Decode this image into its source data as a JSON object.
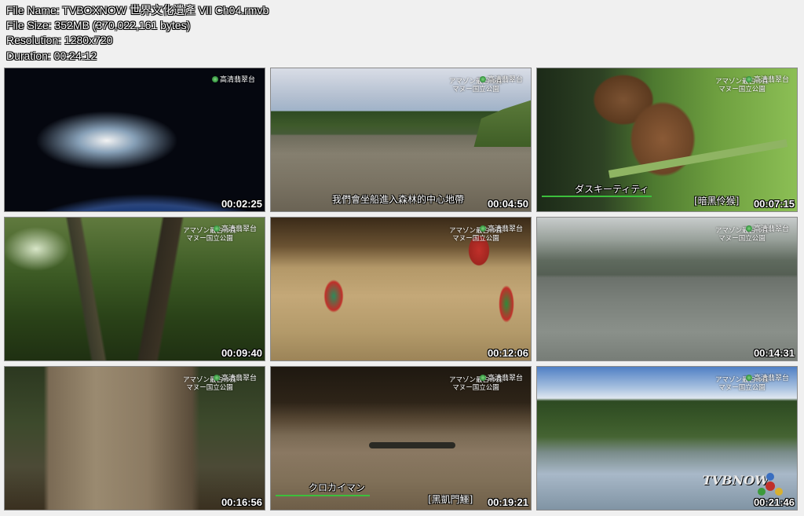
{
  "header": {
    "file_name": "File Name: TVBOXNOW 世界文化遺產 VII Ch04.rmvb",
    "file_size": "File Size: 352MB (370,022,161 bytes)",
    "resolution": "Resolution: 1280x720",
    "duration": "Duration: 00:24:12"
  },
  "overlay": {
    "channel_logo": "高清翡翠台",
    "place_line1": "アマゾン最古の森",
    "place_line2": "マヌー国立公園",
    "watermark": "TVBNOW"
  },
  "thumbnails": [
    {
      "time": "00:02:25"
    },
    {
      "time": "00:04:50",
      "subtitle": "我們會坐船進入森林的中心地帶"
    },
    {
      "time": "00:07:15",
      "caption": "ダスキーティティ",
      "caption2": "[暗黑伶猴]"
    },
    {
      "time": "00:09:40"
    },
    {
      "time": "00:12:06"
    },
    {
      "time": "00:14:31"
    },
    {
      "time": "00:16:56"
    },
    {
      "time": "00:19:21",
      "caption": "クロカイマン",
      "caption2": "[黑凱門鱷]"
    },
    {
      "time": "00:21:46"
    }
  ],
  "colors": {
    "background": "#f0f0f0",
    "thumb_border": "#8a8a8a",
    "caption_line": "#3cbf3c"
  }
}
